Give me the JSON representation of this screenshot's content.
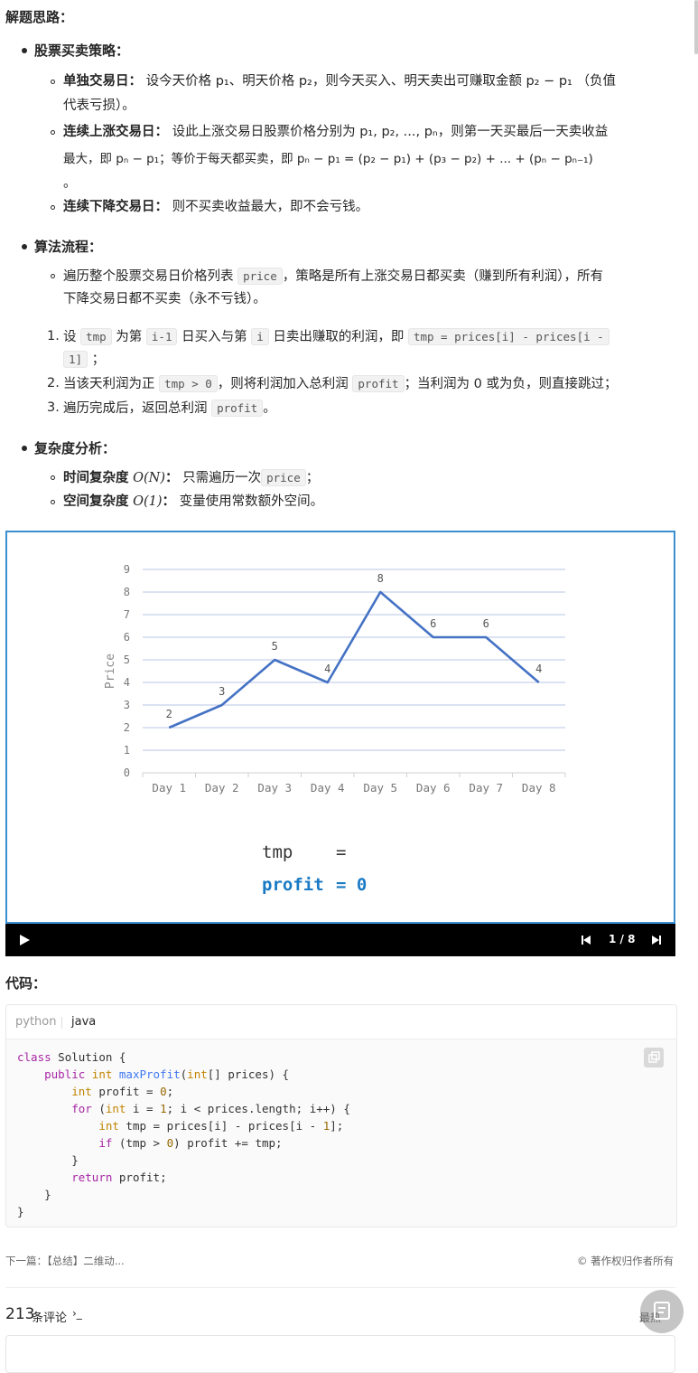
{
  "section_title": "解题思路：",
  "strategy": {
    "heading": "股票买卖策略：",
    "item1": {
      "label": "单独交易日：",
      "text": "设今天价格 p₁、明天价格 p₂，则今天买入、明天卖出可赚取金额 p₂ − p₁ （负值",
      "text2": "代表亏损）。"
    },
    "item2": {
      "label": "连续上涨交易日：",
      "text": "设此上涨交易日股票价格分别为 p₁, p₂, ..., pₙ，则第一天买最后一天卖收益",
      "text2": "最大，即 pₙ − p₁；等价于每天都买卖，即 pₙ − p₁ = (p₂ − p₁) + (p₃ − p₂) + ... + (pₙ − pₙ₋₁)",
      "text3": "。"
    },
    "item3": {
      "label": "连续下降交易日：",
      "text": "则不买卖收益最大，即不会亏钱。"
    }
  },
  "algorithm": {
    "heading": "算法流程：",
    "sub1_a": "遍历整个股票交易日价格列表",
    "sub1_code": "price",
    "sub1_b": "，策略是所有上涨交易日都买卖（赚到所有利润），所有",
    "sub1_c": "下降交易日都不买卖（永不亏钱）。",
    "step1": {
      "num": "1.",
      "a": "设",
      "c1": "tmp",
      "b": "为第",
      "c2": "i-1",
      "c": "日买入与第",
      "c3": "i",
      "d": "日卖出赚取的利润，即",
      "c4": "tmp = prices[i] - prices[i -",
      "c5": "1]",
      "e": "；"
    },
    "step2": {
      "num": "2.",
      "a": "当该天利润为正",
      "c1": "tmp > 0",
      "b": "，则将利润加入总利润",
      "c2": "profit",
      "c": "；当利润为 0 或为负，则直接跳过；"
    },
    "step3": {
      "num": "3.",
      "a": "遍历完成后，返回总利润",
      "c1": "profit",
      "b": "。"
    }
  },
  "complexity": {
    "heading": "复杂度分析：",
    "time_label": "时间复杂度",
    "time_o": "O(N)",
    "time_colon": "：",
    "time_text": "只需遍历一次",
    "time_code": "price",
    "time_end": "；",
    "space_label": "空间复杂度",
    "space_o": "O(1)",
    "space_colon": "：",
    "space_text": "变量使用常数额外空间。"
  },
  "chart_data": {
    "type": "line",
    "categories": [
      "Day 1",
      "Day 2",
      "Day 3",
      "Day 4",
      "Day 5",
      "Day 6",
      "Day 7",
      "Day 8"
    ],
    "values": [
      2,
      3,
      5,
      4,
      8,
      6,
      6,
      4
    ],
    "ylabel": "Price",
    "xlabel": "",
    "ylim": [
      0,
      9
    ],
    "yticks": [
      "0",
      "1",
      "2",
      "3",
      "4",
      "5",
      "6",
      "7",
      "8",
      "9"
    ],
    "grid": true,
    "line_color": "#4472c4"
  },
  "animation": {
    "tmp_label": "tmp",
    "tmp_eq": "=",
    "profit_label": "profit",
    "profit_eq": "= 0",
    "profit_color": "#1a7ac4"
  },
  "player": {
    "counter": "1 / 8"
  },
  "code_title": "代码：",
  "code_tabs": [
    "python",
    "java"
  ],
  "code_lines": [
    "class Solution {",
    "    public int maxProfit(int[] prices) {",
    "        int profit = 0;",
    "        for (int i = 1; i < prices.length; i++) {",
    "            int tmp = prices[i] - prices[i - 1];",
    "            if (tmp > 0) profit += tmp;",
    "        }",
    "        return profit;",
    "    }",
    "}"
  ],
  "footer": {
    "next": "下一篇：【总结】二维动...",
    "copyright": "© 著作权归作者所有"
  },
  "comments": {
    "count": "213",
    "label": "条评论",
    "sort": "最热"
  }
}
